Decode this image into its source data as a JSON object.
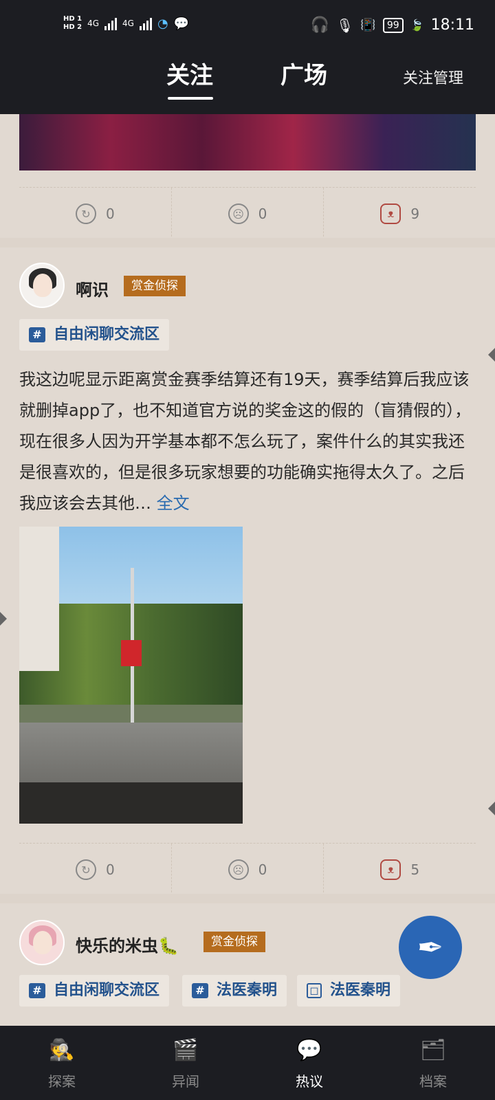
{
  "status_bar": {
    "sim1": "HD 1",
    "sim2": "HD 2",
    "net1": "4G",
    "net2": "4G",
    "battery": "99",
    "time": "18:11"
  },
  "top_nav": {
    "tabs": [
      {
        "label": "关注",
        "active": true
      },
      {
        "label": "广场",
        "active": false
      }
    ],
    "manage_label": "关注管理"
  },
  "posts": [
    {
      "actions": {
        "share": "0",
        "dislike": "0",
        "like": "9"
      }
    },
    {
      "username": "啊识",
      "badge": "赏金侦探",
      "tags": [
        "自由闲聊交流区"
      ],
      "text": "我这边呢显示距离赏金赛季结算还有19天，赛季结算后我应该就删掉app了，也不知道官方说的奖金这的假的（盲猜假的），现在很多人因为开学基本都不怎么玩了，案件什么的其实我还是很喜欢的，但是很多玩家想要的功能确实拖得太久了。之后我应该会去其他…",
      "more_label": "全文",
      "actions": {
        "share": "0",
        "dislike": "0",
        "like": "5"
      }
    },
    {
      "username": "快乐的米虫🐛",
      "badge": "赏金侦探",
      "tags": [
        "自由闲聊交流区",
        "法医秦明",
        "法医秦明"
      ]
    }
  ],
  "bottom_nav": [
    {
      "label": "探案",
      "icon": "detective-pipe-icon",
      "active": false
    },
    {
      "label": "异闻",
      "icon": "video-clapper-icon",
      "active": false
    },
    {
      "label": "热议",
      "icon": "chat-mustache-icon",
      "active": true
    },
    {
      "label": "档案",
      "icon": "profile-folder-icon",
      "active": false
    }
  ],
  "colors": {
    "accent": "#2a66b5",
    "badge": "#b56c1e",
    "tag_text": "#23528c",
    "background": "#e1d9d1",
    "bars": "#1c1d22"
  }
}
